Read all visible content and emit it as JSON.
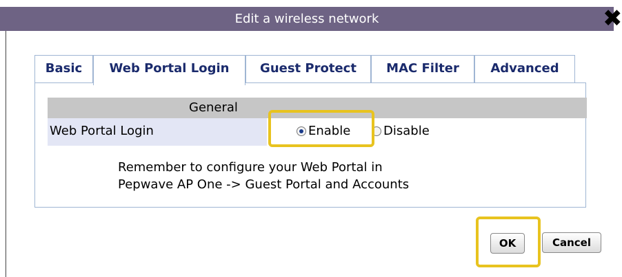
{
  "dialog": {
    "title": "Edit a wireless network",
    "close_glyph": "✖"
  },
  "tabs": [
    {
      "label": "Basic",
      "active": false
    },
    {
      "label": "Web Portal Login",
      "active": true
    },
    {
      "label": "Guest Protect",
      "active": false
    },
    {
      "label": "MAC Filter",
      "active": false
    },
    {
      "label": "Advanced",
      "active": false
    }
  ],
  "section": {
    "header": "General"
  },
  "setting": {
    "label": "Web Portal Login",
    "options": [
      {
        "label": "Enable",
        "checked": true
      },
      {
        "label": "Disable",
        "checked": false
      }
    ]
  },
  "note": {
    "line1": "Remember to configure your Web Portal in",
    "line2": "Pepwave AP One -> Guest Portal and Accounts"
  },
  "buttons": {
    "ok": "OK",
    "cancel": "Cancel"
  },
  "colors": {
    "titlebar": "#6e6384",
    "tab_text": "#1a2a6c",
    "highlight": "#e8c31f",
    "border": "#9fb5d3"
  }
}
